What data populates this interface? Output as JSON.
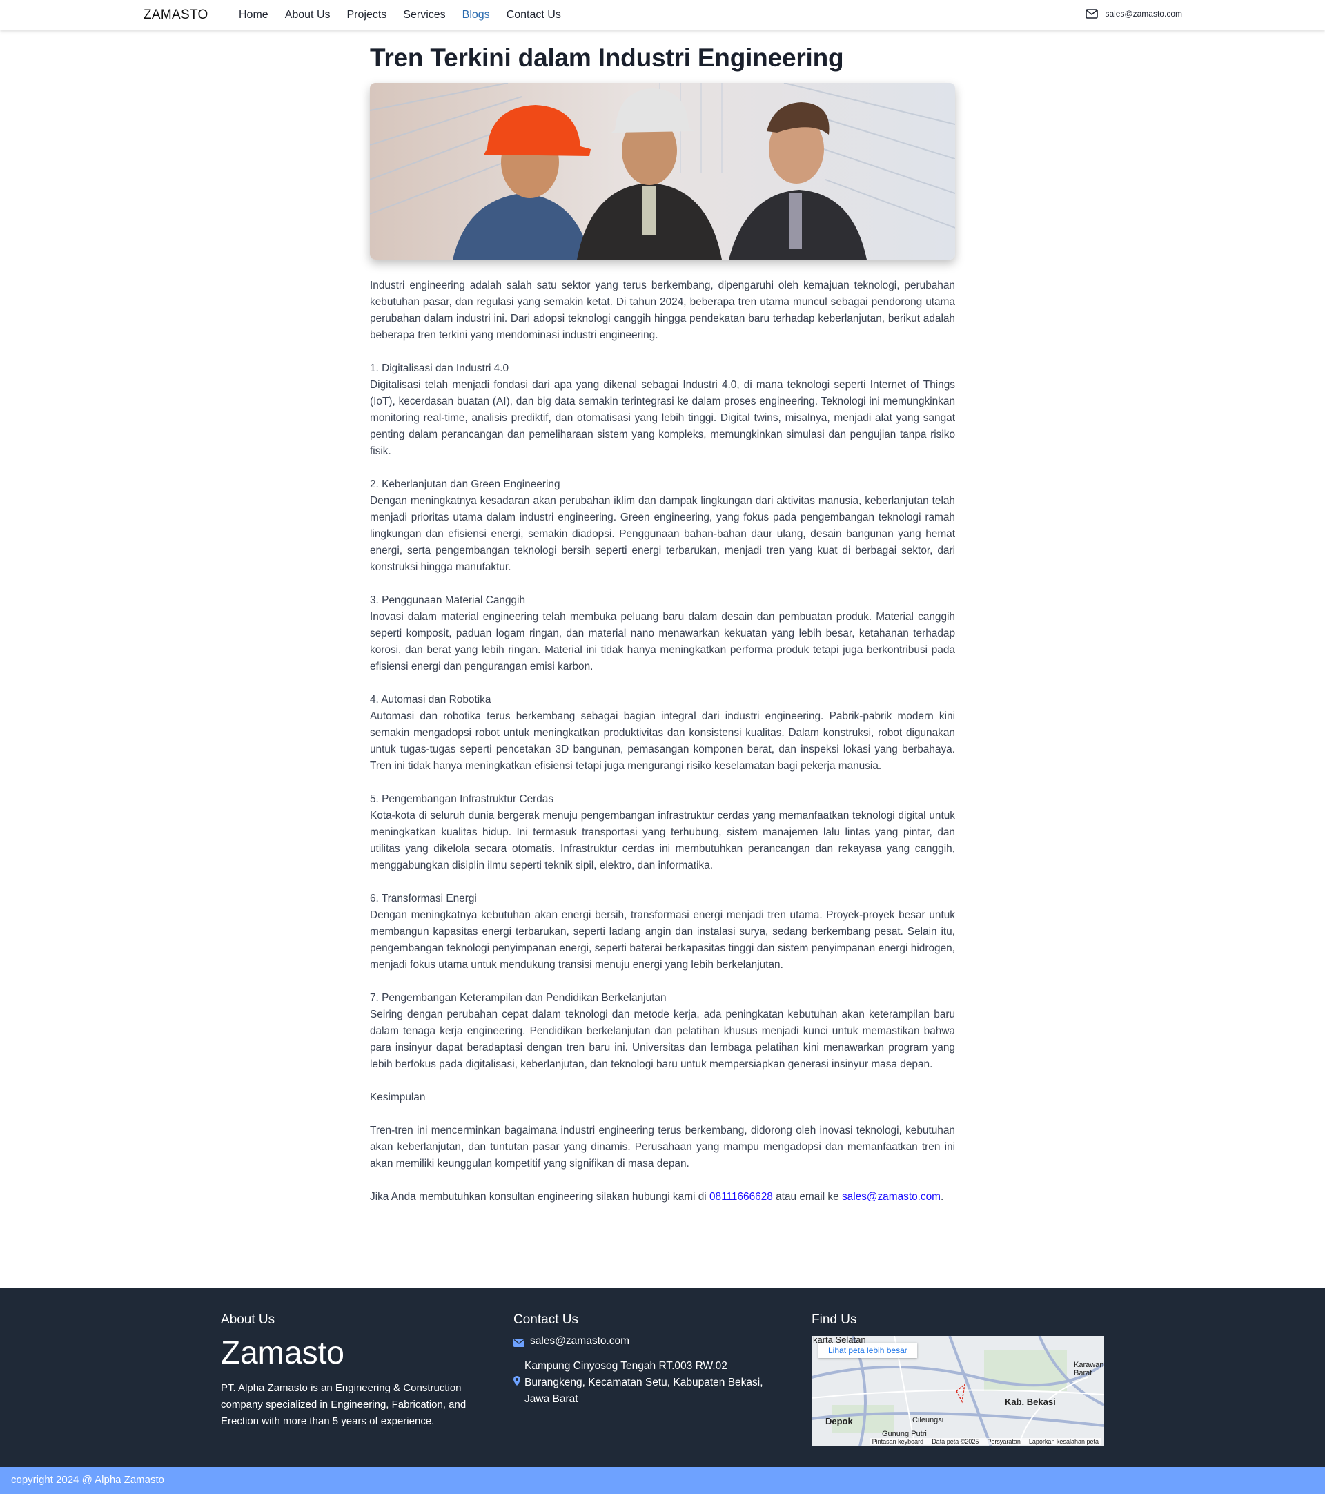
{
  "nav": {
    "brand": "ZAMASTO",
    "links": [
      "Home",
      "About Us",
      "Projects",
      "Services",
      "Blogs",
      "Contact Us"
    ],
    "active_index": 4,
    "email": "sales@zamasto.com"
  },
  "article": {
    "title": "Tren Terkini dalam Industri Engineering",
    "intro": "Industri engineering adalah salah satu sektor yang terus berkembang, dipengaruhi oleh kemajuan teknologi, perubahan kebutuhan pasar, dan regulasi yang semakin ketat. Di tahun 2024, beberapa tren utama muncul sebagai pendorong utama perubahan dalam industri ini. Dari adopsi teknologi canggih hingga pendekatan baru terhadap keberlanjutan, berikut adalah beberapa tren terkini yang mendominasi industri engineering.",
    "sections": [
      {
        "title": "1. Digitalisasi dan Industri 4.0",
        "body": "Digitalisasi telah menjadi fondasi dari apa yang dikenal sebagai Industri 4.0, di mana teknologi seperti Internet of Things (IoT), kecerdasan buatan (AI), dan big data semakin terintegrasi ke dalam proses engineering. Teknologi ini memungkinkan monitoring real-time, analisis prediktif, dan otomatisasi yang lebih tinggi. Digital twins, misalnya, menjadi alat yang sangat penting dalam perancangan dan pemeliharaan sistem yang kompleks, memungkinkan simulasi dan pengujian tanpa risiko fisik."
      },
      {
        "title": "2. Keberlanjutan dan Green Engineering",
        "body": "Dengan meningkatnya kesadaran akan perubahan iklim dan dampak lingkungan dari aktivitas manusia, keberlanjutan telah menjadi prioritas utama dalam industri engineering. Green engineering, yang fokus pada pengembangan teknologi ramah lingkungan dan efisiensi energi, semakin diadopsi. Penggunaan bahan-bahan daur ulang, desain bangunan yang hemat energi, serta pengembangan teknologi bersih seperti energi terbarukan, menjadi tren yang kuat di berbagai sektor, dari konstruksi hingga manufaktur."
      },
      {
        "title": "3. Penggunaan Material Canggih",
        "body": "Inovasi dalam material engineering telah membuka peluang baru dalam desain dan pembuatan produk. Material canggih seperti komposit, paduan logam ringan, dan material nano menawarkan kekuatan yang lebih besar, ketahanan terhadap korosi, dan berat yang lebih ringan. Material ini tidak hanya meningkatkan performa produk tetapi juga berkontribusi pada efisiensi energi dan pengurangan emisi karbon."
      },
      {
        "title": "4. Automasi dan Robotika",
        "body": "Automasi dan robotika terus berkembang sebagai bagian integral dari industri engineering. Pabrik-pabrik modern kini semakin mengadopsi robot untuk meningkatkan produktivitas dan konsistensi kualitas. Dalam konstruksi, robot digunakan untuk tugas-tugas seperti pencetakan 3D bangunan, pemasangan komponen berat, dan inspeksi lokasi yang berbahaya. Tren ini tidak hanya meningkatkan efisiensi tetapi juga mengurangi risiko keselamatan bagi pekerja manusia."
      },
      {
        "title": "5. Pengembangan Infrastruktur Cerdas",
        "body": "Kota-kota di seluruh dunia bergerak menuju pengembangan infrastruktur cerdas yang memanfaatkan teknologi digital untuk meningkatkan kualitas hidup. Ini termasuk transportasi yang terhubung, sistem manajemen lalu lintas yang pintar, dan utilitas yang dikelola secara otomatis. Infrastruktur cerdas ini membutuhkan perancangan dan rekayasa yang canggih, menggabungkan disiplin ilmu seperti teknik sipil, elektro, dan informatika."
      },
      {
        "title": "6. Transformasi Energi",
        "body": "Dengan meningkatnya kebutuhan akan energi bersih, transformasi energi menjadi tren utama. Proyek-proyek besar untuk membangun kapasitas energi terbarukan, seperti ladang angin dan instalasi surya, sedang berkembang pesat. Selain itu, pengembangan teknologi penyimpanan energi, seperti baterai berkapasitas tinggi dan sistem penyimpanan energi hidrogen, menjadi fokus utama untuk mendukung transisi menuju energi yang lebih berkelanjutan."
      },
      {
        "title": "7. Pengembangan Keterampilan dan Pendidikan Berkelanjutan",
        "body": "Seiring dengan perubahan cepat dalam teknologi dan metode kerja, ada peningkatan kebutuhan akan keterampilan baru dalam tenaga kerja engineering. Pendidikan berkelanjutan dan pelatihan khusus menjadi kunci untuk memastikan bahwa para insinyur dapat beradaptasi dengan tren baru ini. Universitas dan lembaga pelatihan kini menawarkan program yang lebih berfokus pada digitalisasi, keberlanjutan, dan teknologi baru untuk mempersiapkan generasi insinyur masa depan."
      }
    ],
    "conclusion_title": "Kesimpulan",
    "conclusion": "Tren-tren ini mencerminkan bagaimana industri engineering terus berkembang, didorong oleh inovasi teknologi, kebutuhan akan keberlanjutan, dan tuntutan pasar yang dinamis. Perusahaan yang mampu mengadopsi dan memanfaatkan tren ini akan memiliki keunggulan kompetitif yang signifikan di masa depan.",
    "cta_prefix": "Jika Anda membutuhkan konsultan engineering silakan hubungi kami di ",
    "cta_phone": "08111666628",
    "cta_mid": " atau email ke ",
    "cta_email": "sales@zamasto.com",
    "cta_suffix": "."
  },
  "footer": {
    "about_heading": "About Us",
    "company_name": "Zamasto",
    "description": "PT. Alpha Zamasto is an Engineering & Construction company specialized in Engineering, Fabrication, and Erection with more than 5 years of experience.",
    "contact_heading": "Contact Us",
    "email": "sales@zamasto.com",
    "address": "Kampung Cinyosog Tengah RT.003 RW.02 Burangkeng, Kecamatan Setu, Kabupaten Bekasi, Jawa Barat",
    "find_heading": "Find Us",
    "map": {
      "button": "Lihat peta lebih besar",
      "labels": [
        "karta Selatan",
        "Kab. Bekasi",
        "Depok",
        "Cileungsi",
        "Gunung Putri",
        "Karawan Barat"
      ],
      "footer": [
        "Pintasan keyboard",
        "Data peta ©2025",
        "Persyaratan",
        "Laporkan kesalahan peta"
      ]
    },
    "copyright": "copyright 2024 @ Alpha Zamasto"
  },
  "colors": {
    "accent": "#2b6cb0",
    "link": "#1a0dff",
    "footer_bg": "#1f2937",
    "bottom_bar": "#6ea2ff"
  }
}
